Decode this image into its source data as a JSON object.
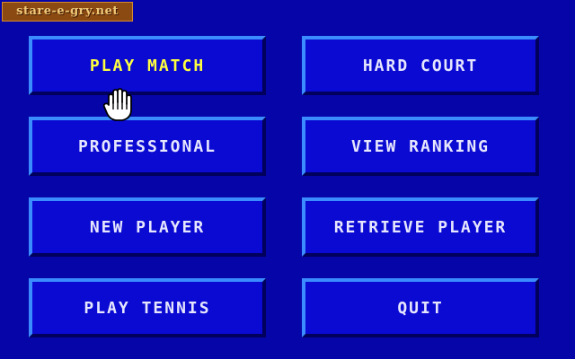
{
  "watermark": {
    "text": "stare-e-gry.net"
  },
  "menu": {
    "play_match": "PLAY MATCH",
    "hard_court": "HARD COURT",
    "professional": "PROFESSIONAL",
    "view_ranking": "VIEW RANKING",
    "new_player": "NEW PLAYER",
    "retrieve_player": "RETRIEVE PLAYER",
    "play_tennis": "PLAY TENNIS",
    "quit": "QUIT"
  },
  "colors": {
    "background": "#0505a8",
    "button_face": "#0a0ad2",
    "button_highlight": "#3a8cff",
    "button_shadow": "#00005c",
    "label_normal": "#e6e6ff",
    "label_selected": "#ffff40"
  },
  "cursor": {
    "icon": "hand-pointer-icon"
  }
}
